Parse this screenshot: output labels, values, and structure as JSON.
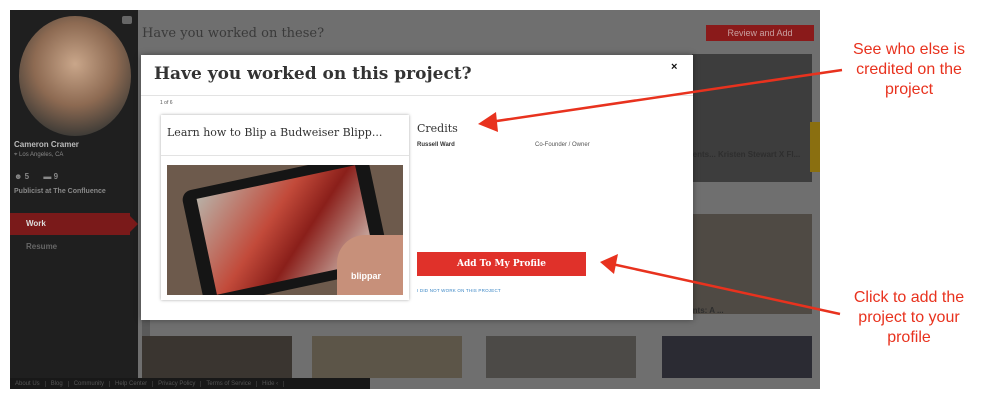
{
  "sidebar": {
    "user_name": "Cameron Cramer",
    "location": "Los Angeles, CA",
    "count_people": "5",
    "count_projects": "9",
    "job": "Publicist at The Confluence",
    "nav_work": "Work",
    "nav_resume": "Resume"
  },
  "page": {
    "heading": "Have you worked on these?",
    "review_button": "Review and Add",
    "bg_tile_text": "...ents... Kristen Stewart X Fl...",
    "bg_tile_text2": "...nts: A ..."
  },
  "footer": {
    "links": [
      "About Us",
      "Blog",
      "Community",
      "Help Center",
      "Privacy Policy",
      "Terms of Service",
      "Hide"
    ]
  },
  "modal": {
    "title": "Have you worked on this project?",
    "close_label": "×",
    "pager": "1 of 6",
    "project_title": "Learn how to Blip a Budweiser Blipp...",
    "image_logo": "blippar",
    "credits_heading": "Credits",
    "credits": [
      {
        "name": "Russell Ward",
        "role": "Co-Founder / Owner"
      }
    ],
    "add_button": "Add To My Profile",
    "not_worked_link": "I DID NOT WORK ON THIS PROJECT"
  },
  "annotations": {
    "credits_note_lines": [
      "See who else is",
      "credited on the",
      "project"
    ],
    "add_note_lines": [
      "Click to add the",
      "project to your",
      "profile"
    ],
    "color": "#e8321e"
  },
  "colors": {
    "accent_red": "#e0312a",
    "link_blue": "#3a86c5",
    "overlay_gray": "#6f6f6f"
  }
}
